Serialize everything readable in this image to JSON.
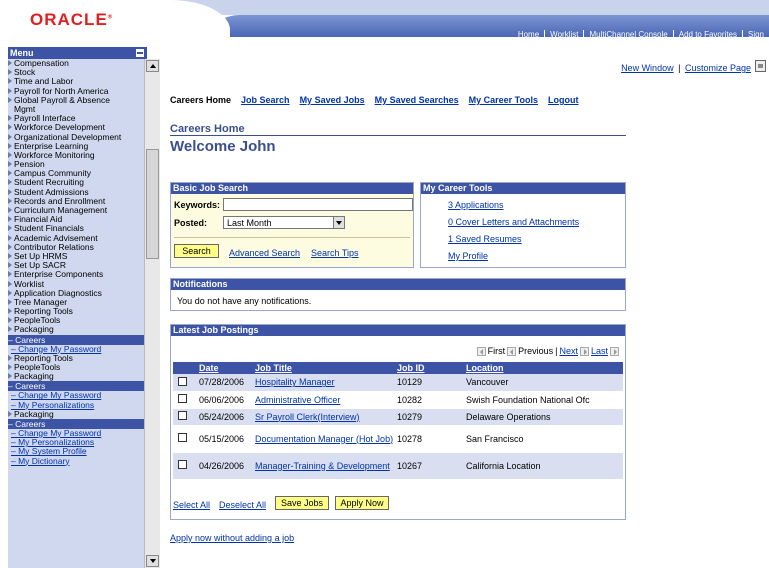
{
  "header": {
    "logo": "ORACLE",
    "top_links": [
      "Home",
      "Worklist",
      "MultiChannel Console",
      "Add to Favorites",
      "Sign"
    ]
  },
  "menu": {
    "title": "Menu",
    "items": [
      {
        "label": "Compensation",
        "type": "folder"
      },
      {
        "label": "Stock",
        "type": "folder"
      },
      {
        "label": "Time and Labor",
        "type": "folder"
      },
      {
        "label": "Payroll for North America",
        "type": "folder"
      },
      {
        "label": "Global Payroll & Absence",
        "type": "folder"
      },
      {
        "label": "Mgmt",
        "type": "wrap"
      },
      {
        "label": "Payroll Interface",
        "type": "folder"
      },
      {
        "label": "Workforce Development",
        "type": "folder"
      },
      {
        "label": "Organizational Development",
        "type": "folder"
      },
      {
        "label": "Enterprise Learning",
        "type": "folder"
      },
      {
        "label": "Workforce Monitoring",
        "type": "folder"
      },
      {
        "label": "Pension",
        "type": "folder"
      },
      {
        "label": "Campus Community",
        "type": "folder"
      },
      {
        "label": "Student Recruiting",
        "type": "folder"
      },
      {
        "label": "Student Admissions",
        "type": "folder"
      },
      {
        "label": "Records and Enrollment",
        "type": "folder"
      },
      {
        "label": "Curriculum Management",
        "type": "folder"
      },
      {
        "label": "Financial Aid",
        "type": "folder"
      },
      {
        "label": "Student Financials",
        "type": "folder"
      },
      {
        "label": "Academic Advisement",
        "type": "folder"
      },
      {
        "label": "Contributor Relations",
        "type": "folder"
      },
      {
        "label": "Set Up HRMS",
        "type": "folder"
      },
      {
        "label": "Set Up SACR",
        "type": "folder"
      },
      {
        "label": "Enterprise Components",
        "type": "folder"
      },
      {
        "label": "Worklist",
        "type": "folder"
      },
      {
        "label": "Application Diagnostics",
        "type": "folder"
      },
      {
        "label": "Tree Manager",
        "type": "folder"
      },
      {
        "label": "Reporting Tools",
        "type": "folder"
      },
      {
        "label": "PeopleTools",
        "type": "folder"
      },
      {
        "label": "Packaging",
        "type": "folder"
      },
      {
        "label": "– Careers",
        "type": "selected"
      },
      {
        "label": "– Change My Password",
        "type": "sub"
      },
      {
        "label": "Reporting Tools",
        "type": "folder"
      },
      {
        "label": "PeopleTools",
        "type": "folder"
      },
      {
        "label": "Packaging",
        "type": "folder"
      },
      {
        "label": "– Careers",
        "type": "selected"
      },
      {
        "label": "– Change My Password",
        "type": "sub"
      },
      {
        "label": "– My Personalizations",
        "type": "sub"
      },
      {
        "label": "Packaging",
        "type": "folder"
      },
      {
        "label": "– Careers",
        "type": "selected"
      },
      {
        "label": "– Change My Password",
        "type": "sub"
      },
      {
        "label": "– My Personalizations",
        "type": "sub"
      },
      {
        "label": "– My System Profile",
        "type": "sub"
      },
      {
        "label": "– My Dictionary",
        "type": "sub"
      }
    ]
  },
  "utility_links": {
    "new_window": "New Window",
    "customize": "Customize Page",
    "separator": "|"
  },
  "nav": {
    "current": "Careers Home",
    "links": [
      "Job Search",
      "My Saved Jobs",
      "My Saved Searches",
      "My Career Tools",
      "Logout"
    ]
  },
  "section_title": "Careers Home",
  "welcome": "Welcome John",
  "job_search": {
    "title": "Basic Job Search",
    "keywords_label": "Keywords:",
    "keywords_value": "",
    "posted_label": "Posted:",
    "posted_value": "Last Month",
    "search_button": "Search",
    "advanced_link": "Advanced Search",
    "tips_link": "Search Tips"
  },
  "career_tools": {
    "title": "My Career Tools",
    "links": [
      "3 Applications",
      "0 Cover Letters and Attachments",
      "1 Saved Resumes",
      "My Profile"
    ]
  },
  "notifications": {
    "title": "Notifications",
    "message": "You do not have any notifications."
  },
  "postings": {
    "title": "Latest Job Postings",
    "pager": {
      "first": "First",
      "previous": "Previous",
      "next": "Next",
      "last": "Last",
      "sep": "|"
    },
    "columns": [
      "Date",
      "Job Title",
      "Job ID",
      "Location"
    ],
    "rows": [
      {
        "date": "07/28/2006",
        "title": "Hospitality Manager",
        "id": "10129",
        "location": "Vancouver"
      },
      {
        "date": "06/06/2006",
        "title": "Administrative Officer",
        "id": "10282",
        "location": "Swish Foundation National Ofc"
      },
      {
        "date": "05/24/2006",
        "title": "Sr Payroll Clerk(Interview)",
        "id": "10279",
        "location": "Delaware Operations"
      },
      {
        "date": "05/15/2006",
        "title": "Documentation Manager (Hot Job)",
        "id": "10278",
        "location": "San Francisco"
      },
      {
        "date": "04/26/2006",
        "title": "Manager-Training & Development",
        "id": "10267",
        "location": "California Location"
      }
    ],
    "select_all": "Select All",
    "deselect_all": "Deselect All",
    "save_button": "Save Jobs",
    "apply_button": "Apply Now"
  },
  "apply_without_job": "Apply now without adding a job",
  "colors": {
    "brand_red": "#e02020",
    "header_blue": "#3c53a6",
    "link_blue": "#0033aa",
    "menu_bg": "#cfd8ee",
    "button_yellow": "#ffff88"
  }
}
